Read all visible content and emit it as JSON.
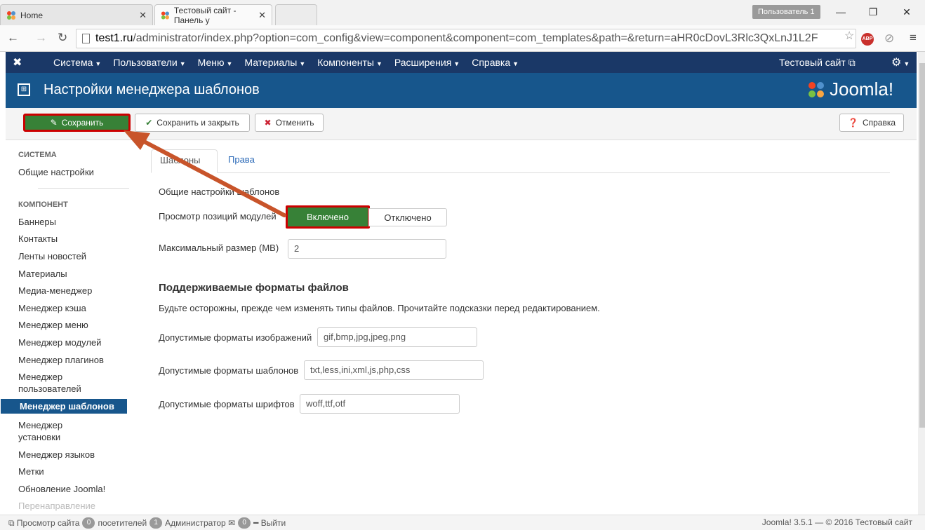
{
  "browser": {
    "tabs": [
      {
        "label": "Home"
      },
      {
        "label": "Тестовый сайт - Панель у"
      }
    ],
    "user_badge": "Пользователь 1",
    "address": {
      "host": "test1.ru",
      "path": "/administrator/index.php?option=com_config&view=component&component=com_templates&path=&return=aHR0cDovL3Rlc3QxLnJ1L2F"
    },
    "abp_label": "ABP"
  },
  "topnav": {
    "items": [
      "Система",
      "Пользователи",
      "Меню",
      "Материалы",
      "Компоненты",
      "Расширения",
      "Справка"
    ],
    "site_link": "Тестовый сайт"
  },
  "header": {
    "title": "Настройки менеджера шаблонов",
    "brand": "Joomla!"
  },
  "toolbar": {
    "save": "Сохранить",
    "save_close": "Сохранить и закрыть",
    "cancel": "Отменить",
    "help": "Справка"
  },
  "sidebar": {
    "section_system": "СИСТЕМА",
    "general": "Общие настройки",
    "section_component": "КОМПОНЕНТ",
    "items": [
      "Баннеры",
      "Контакты",
      "Ленты новостей",
      "Материалы",
      "Медиа-менеджер",
      "Менеджер кэша",
      "Менеджер меню",
      "Менеджер модулей",
      "Менеджер плагинов",
      "Менеджер пользователей",
      "Менеджер шаблонов",
      "Менеджер установки",
      "Менеджер языков",
      "Метки",
      "Обновление Joomla!",
      "Перенаправление"
    ]
  },
  "main": {
    "tabs": [
      "Шаблоны",
      "Права"
    ],
    "general_label": "Общие настройки шаблонов",
    "preview_label": "Просмотр позиций модулей",
    "toggle_on": "Включено",
    "toggle_off": "Отключено",
    "max_size_label": "Максимальный размер (MB)",
    "max_size_value": "2",
    "formats_title": "Поддерживаемые форматы файлов",
    "formats_note": "Будьте осторожны, прежде чем изменять типы файлов. Прочитайте подсказки перед редактированием.",
    "image_formats_label": "Допустимые форматы изображений",
    "image_formats_value": "gif,bmp,jpg,jpeg,png",
    "template_formats_label": "Допустимые форматы шаблонов",
    "template_formats_value": "txt,less,ini,xml,js,php,css",
    "font_formats_label": "Допустимые форматы шрифтов",
    "font_formats_value": "woff,ttf,otf"
  },
  "statusbar": {
    "view_site": "Просмотр сайта",
    "visitors_count": "0",
    "visitors_label": "посетителей",
    "admins_count": "1",
    "admins_label": "Администратор",
    "messages_count": "0",
    "logout": "Выйти",
    "footer": "Joomla! 3.5.1 — © 2016 Тестовый сайт"
  },
  "colors": {
    "topnav": "#1a3867",
    "header": "#17568c",
    "save_green": "#378137",
    "highlight_red": "#cc0000",
    "arrow": "#c8542a"
  }
}
